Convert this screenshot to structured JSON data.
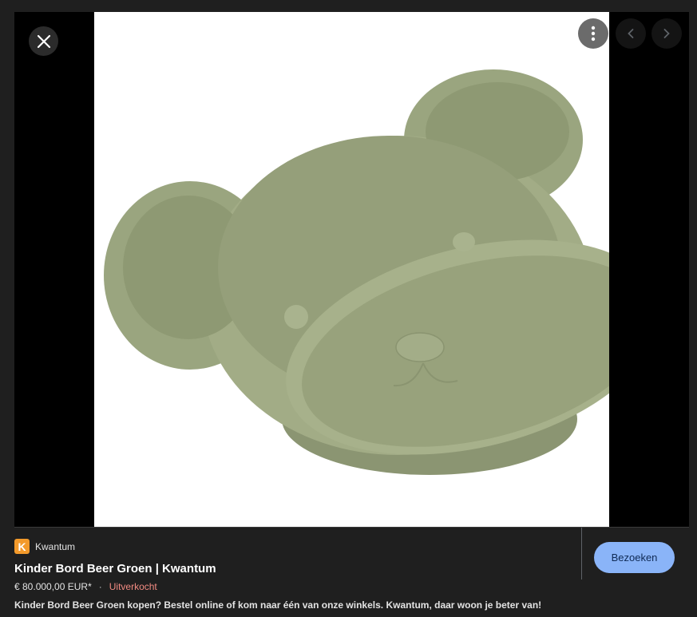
{
  "viewer": {
    "close_icon": "close-icon",
    "more_icon": "more-vert-icon",
    "prev_icon": "chevron-left-icon",
    "next_icon": "chevron-right-icon",
    "image_subject": "green silicone bear-shaped divided plate"
  },
  "result": {
    "source_logo_letter": "K",
    "source_name": "Kwantum",
    "title": "Kinder Bord Beer Groen | Kwantum",
    "price": "€ 80.000,00 EUR*",
    "separator": "·",
    "stock_status": "Uitverkocht",
    "description": "Kinder Bord Beer Groen kopen? Bestel online of kom naar één van onze winkels. Kwantum, daar woon je beter van!",
    "visit_label": "Bezoeken"
  },
  "colors": {
    "background": "#1f1f1f",
    "viewer_bg": "#000000",
    "accent_button": "#8ab4f8",
    "stock_red": "#f28b82",
    "logo_orange": "#f39a2b",
    "plate_green": "#a5af8a"
  }
}
